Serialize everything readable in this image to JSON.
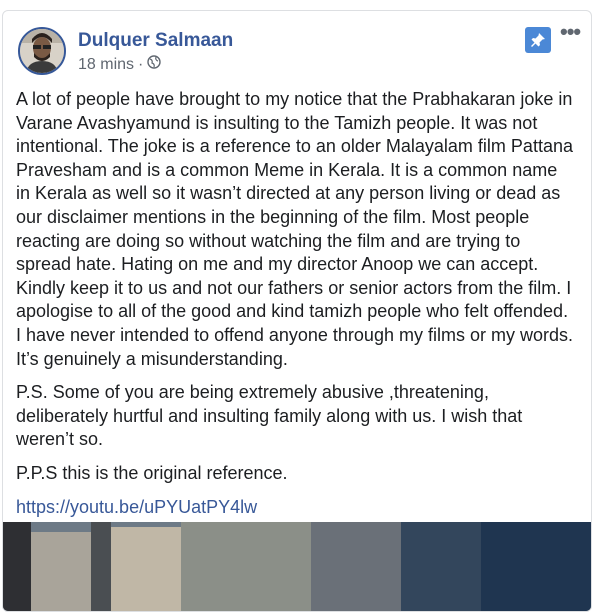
{
  "post": {
    "author": "Dulquer Salmaan",
    "time": "18 mins",
    "separator": "·",
    "icons": {
      "audience": "globe-icon",
      "pin": "pin-icon",
      "more": "more-options-icon"
    },
    "paragraphs": [
      "A lot of people have brought to my notice that the Prabhakaran joke in Varane Avashyamund is insulting to the Tamizh people. It was not intentional. The joke is a reference to an older Malayalam film Pattana Pravesham and is a common Meme in Kerala. It is a common name in Kerala as well so it wasn’t directed at any person living or dead as our disclaimer mentions in the beginning of the film. Most people reacting are doing so without watching the film and are trying to spread hate. Hating on me and my director Anoop we can accept. Kindly keep it to us and not our fathers or senior actors from the film. I apologise to all of the good and kind tamizh people who felt offended. I have never intended to offend anyone through my films or my words. It’s genuinely a misunderstanding.",
      "P.S. Some of you are being extremely abusive ,threatening, deliberately hurtful and insulting family along with us. I wish that weren’t so.",
      "P.P.S this is the original reference."
    ],
    "link": "https://youtu.be/uPYUatPY4lw"
  },
  "colors": {
    "name": "#385898",
    "pin_bg": "#4b88d6",
    "text": "#1c1e21",
    "meta": "#606770"
  }
}
